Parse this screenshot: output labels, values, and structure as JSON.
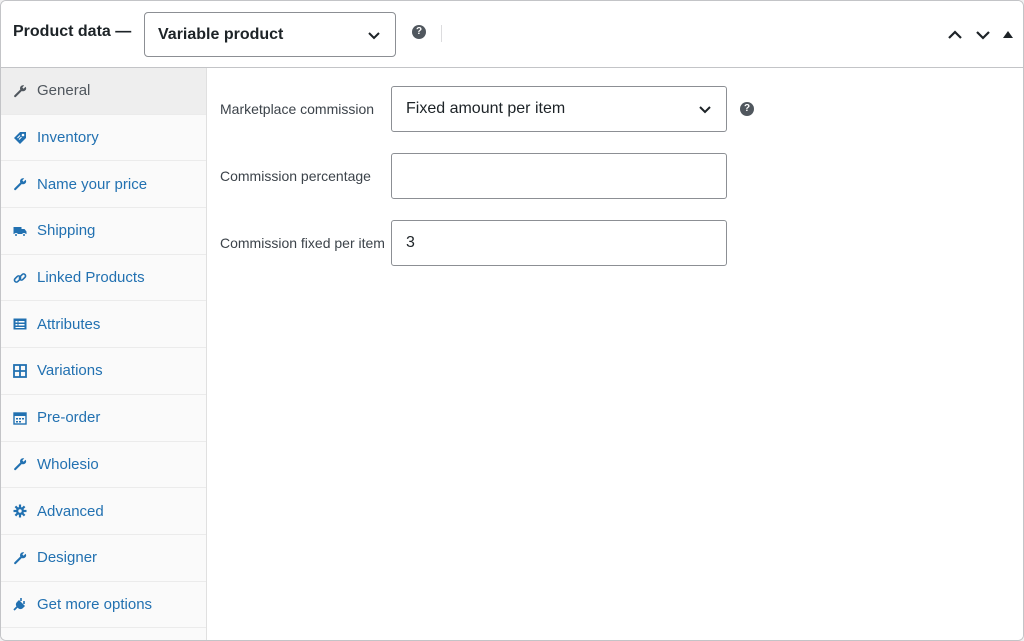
{
  "header": {
    "title": "Product data —",
    "product_type": "Variable product"
  },
  "tabs": [
    {
      "label": "General",
      "icon": "wrench-icon",
      "active": true
    },
    {
      "label": "Inventory",
      "icon": "tag-icon"
    },
    {
      "label": "Name your price",
      "icon": "wrench-icon"
    },
    {
      "label": "Shipping",
      "icon": "truck-icon"
    },
    {
      "label": "Linked Products",
      "icon": "link-icon"
    },
    {
      "label": "Attributes",
      "icon": "list-icon"
    },
    {
      "label": "Variations",
      "icon": "grid-icon"
    },
    {
      "label": "Pre-order",
      "icon": "calendar-icon"
    },
    {
      "label": "Wholesio",
      "icon": "wrench-icon"
    },
    {
      "label": "Advanced",
      "icon": "gear-icon"
    },
    {
      "label": "Designer",
      "icon": "wrench-icon"
    },
    {
      "label": "Get more options",
      "icon": "plug-icon"
    }
  ],
  "fields": {
    "marketplace_commission": {
      "label": "Marketplace commission",
      "value": "Fixed amount per item"
    },
    "commission_percentage": {
      "label": "Commission percentage",
      "value": ""
    },
    "commission_fixed": {
      "label": "Commission fixed per item",
      "value": "3"
    }
  },
  "colors": {
    "link": "#2271b1",
    "active_tab_bg": "#eeeeee"
  }
}
